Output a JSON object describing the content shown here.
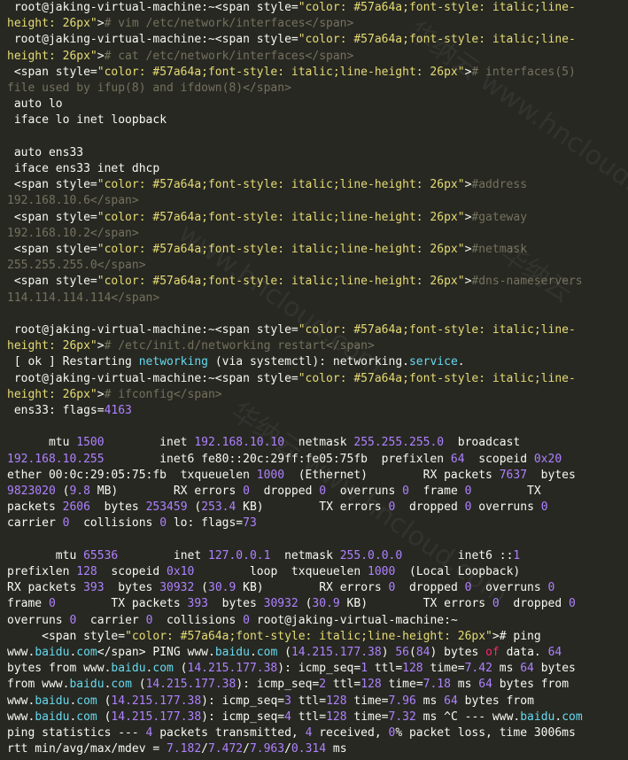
{
  "terminal": {
    "lines": [
      [
        {
          "t": " root@jaking-virtual-machine:~<span style=",
          "c": ""
        },
        {
          "t": "\"color: #57a64a;font-style: italic;line-",
          "c": "st"
        }
      ],
      [
        {
          "t": "height: 26px\"",
          "c": "st"
        },
        {
          "t": ">",
          "c": ""
        },
        {
          "t": "# vim /etc/network/interfaces</span>",
          "c": "cm"
        }
      ],
      [
        {
          "t": " root@jaking-virtual-machine:~<span style=",
          "c": ""
        },
        {
          "t": "\"color: #57a64a;font-style: italic;line-",
          "c": "st"
        }
      ],
      [
        {
          "t": "height: 26px\"",
          "c": "st"
        },
        {
          "t": ">",
          "c": ""
        },
        {
          "t": "# cat /etc/network/interfaces</span>",
          "c": "cm"
        }
      ],
      [
        {
          "t": " <span style=",
          "c": ""
        },
        {
          "t": "\"color: #57a64a;font-style: italic;line-height: 26px\"",
          "c": "st"
        },
        {
          "t": ">",
          "c": ""
        },
        {
          "t": "# interfaces(5)",
          "c": "cm"
        }
      ],
      [
        {
          "t": "file used by ifup(8) and ifdown(8)</span>",
          "c": "cm"
        }
      ],
      [
        {
          "t": " auto lo",
          "c": ""
        }
      ],
      [
        {
          "t": " iface lo inet loopback",
          "c": ""
        }
      ],
      [],
      [
        {
          "t": " auto ens33",
          "c": ""
        }
      ],
      [
        {
          "t": " iface ens33 inet dhcp",
          "c": ""
        }
      ],
      [
        {
          "t": " <span style=",
          "c": ""
        },
        {
          "t": "\"color: #57a64a;font-style: italic;line-height: 26px\"",
          "c": "st"
        },
        {
          "t": ">",
          "c": ""
        },
        {
          "t": "#address",
          "c": "cm"
        }
      ],
      [
        {
          "t": "192.168.10.6</span>",
          "c": "cm"
        }
      ],
      [
        {
          "t": " <span style=",
          "c": ""
        },
        {
          "t": "\"color: #57a64a;font-style: italic;line-height: 26px\"",
          "c": "st"
        },
        {
          "t": ">",
          "c": ""
        },
        {
          "t": "#gateway",
          "c": "cm"
        }
      ],
      [
        {
          "t": "192.168.10.2</span>",
          "c": "cm"
        }
      ],
      [
        {
          "t": " <span style=",
          "c": ""
        },
        {
          "t": "\"color: #57a64a;font-style: italic;line-height: 26px\"",
          "c": "st"
        },
        {
          "t": ">",
          "c": ""
        },
        {
          "t": "#netmask",
          "c": "cm"
        }
      ],
      [
        {
          "t": "255.255.255.0</span>",
          "c": "cm"
        }
      ],
      [
        {
          "t": " <span style=",
          "c": ""
        },
        {
          "t": "\"color: #57a64a;font-style: italic;line-height: 26px\"",
          "c": "st"
        },
        {
          "t": ">",
          "c": ""
        },
        {
          "t": "#dns-nameservers",
          "c": "cm"
        }
      ],
      [
        {
          "t": "114.114.114.114</span>",
          "c": "cm"
        }
      ],
      [],
      [
        {
          "t": " root@jaking-virtual-machine:~<span style=",
          "c": ""
        },
        {
          "t": "\"color: #57a64a;font-style: italic;line-",
          "c": "st"
        }
      ],
      [
        {
          "t": "height: 26px\"",
          "c": "st"
        },
        {
          "t": ">",
          "c": ""
        },
        {
          "t": "# /etc/init.d/networking restart</span>",
          "c": "cm"
        }
      ],
      [
        {
          "t": " [ ok ] Restarting ",
          "c": ""
        },
        {
          "t": "networking",
          "c": "kw"
        },
        {
          "t": " (via systemctl): networking.",
          "c": ""
        },
        {
          "t": "service",
          "c": "kw"
        },
        {
          "t": ".",
          "c": ""
        }
      ],
      [
        {
          "t": " root@jaking-virtual-machine:~<span style=",
          "c": ""
        },
        {
          "t": "\"color: #57a64a;font-style: italic;line-",
          "c": "st"
        }
      ],
      [
        {
          "t": "height: 26px\"",
          "c": "st"
        },
        {
          "t": ">",
          "c": ""
        },
        {
          "t": "# ifconfig</span>",
          "c": "cm"
        }
      ],
      [
        {
          "t": " ens33: flags=",
          "c": ""
        },
        {
          "t": "4163",
          "c": "nm"
        }
      ],
      [],
      [
        {
          "t": "      mtu ",
          "c": ""
        },
        {
          "t": "1500",
          "c": "nm"
        },
        {
          "t": "        inet ",
          "c": ""
        },
        {
          "t": "192.168.10.10",
          "c": "nm"
        },
        {
          "t": "  netmask ",
          "c": ""
        },
        {
          "t": "255.255.255.0",
          "c": "nm"
        },
        {
          "t": "  broadcast",
          "c": ""
        }
      ],
      [
        {
          "t": "192.168.10.255",
          "c": "nm"
        },
        {
          "t": "        inet6 fe80::20c:29ff:fe05:75fb  prefixlen ",
          "c": ""
        },
        {
          "t": "64",
          "c": "nm"
        },
        {
          "t": "  scopeid ",
          "c": ""
        },
        {
          "t": "0x20",
          "c": "nm"
        }
      ],
      [
        {
          "t": "ether 00:0c:29:05:75:fb  txqueuelen ",
          "c": ""
        },
        {
          "t": "1000",
          "c": "nm"
        },
        {
          "t": "  (Ethernet)        RX packets ",
          "c": ""
        },
        {
          "t": "7637",
          "c": "nm"
        },
        {
          "t": "  bytes",
          "c": ""
        }
      ],
      [
        {
          "t": "9823020",
          "c": "nm"
        },
        {
          "t": " (",
          "c": ""
        },
        {
          "t": "9.8",
          "c": "nm"
        },
        {
          "t": " MB)        RX errors ",
          "c": ""
        },
        {
          "t": "0",
          "c": "nm"
        },
        {
          "t": "  dropped ",
          "c": ""
        },
        {
          "t": "0",
          "c": "nm"
        },
        {
          "t": "  overruns ",
          "c": ""
        },
        {
          "t": "0",
          "c": "nm"
        },
        {
          "t": "  frame ",
          "c": ""
        },
        {
          "t": "0",
          "c": "nm"
        },
        {
          "t": "        TX",
          "c": ""
        }
      ],
      [
        {
          "t": "packets ",
          "c": ""
        },
        {
          "t": "2606",
          "c": "nm"
        },
        {
          "t": "  bytes ",
          "c": ""
        },
        {
          "t": "253459",
          "c": "nm"
        },
        {
          "t": " (",
          "c": ""
        },
        {
          "t": "253.4",
          "c": "nm"
        },
        {
          "t": " KB)        TX errors ",
          "c": ""
        },
        {
          "t": "0",
          "c": "nm"
        },
        {
          "t": "  dropped ",
          "c": ""
        },
        {
          "t": "0",
          "c": "nm"
        },
        {
          "t": " overruns ",
          "c": ""
        },
        {
          "t": "0",
          "c": "nm"
        }
      ],
      [
        {
          "t": "carrier ",
          "c": ""
        },
        {
          "t": "0",
          "c": "nm"
        },
        {
          "t": "  collisions ",
          "c": ""
        },
        {
          "t": "0",
          "c": "nm"
        },
        {
          "t": " lo: flags=",
          "c": ""
        },
        {
          "t": "73",
          "c": "nm"
        }
      ],
      [],
      [
        {
          "t": "       mtu ",
          "c": ""
        },
        {
          "t": "65536",
          "c": "nm"
        },
        {
          "t": "        inet ",
          "c": ""
        },
        {
          "t": "127.0.0.1",
          "c": "nm"
        },
        {
          "t": "  netmask ",
          "c": ""
        },
        {
          "t": "255.0.0.0",
          "c": "nm"
        },
        {
          "t": "        inet6 ::",
          "c": ""
        },
        {
          "t": "1",
          "c": "nm"
        }
      ],
      [
        {
          "t": "prefixlen ",
          "c": ""
        },
        {
          "t": "128",
          "c": "nm"
        },
        {
          "t": "  scopeid ",
          "c": ""
        },
        {
          "t": "0x10",
          "c": "nm"
        },
        {
          "t": "        loop  txqueuelen ",
          "c": ""
        },
        {
          "t": "1000",
          "c": "nm"
        },
        {
          "t": "  (Local Loopback)",
          "c": ""
        }
      ],
      [
        {
          "t": "RX packets ",
          "c": ""
        },
        {
          "t": "393",
          "c": "nm"
        },
        {
          "t": "  bytes ",
          "c": ""
        },
        {
          "t": "30932",
          "c": "nm"
        },
        {
          "t": " (",
          "c": ""
        },
        {
          "t": "30.9",
          "c": "nm"
        },
        {
          "t": " KB)        RX errors ",
          "c": ""
        },
        {
          "t": "0",
          "c": "nm"
        },
        {
          "t": "  dropped ",
          "c": ""
        },
        {
          "t": "0",
          "c": "nm"
        },
        {
          "t": "  overruns ",
          "c": ""
        },
        {
          "t": "0",
          "c": "nm"
        }
      ],
      [
        {
          "t": "frame ",
          "c": ""
        },
        {
          "t": "0",
          "c": "nm"
        },
        {
          "t": "        TX packets ",
          "c": ""
        },
        {
          "t": "393",
          "c": "nm"
        },
        {
          "t": "  bytes ",
          "c": ""
        },
        {
          "t": "30932",
          "c": "nm"
        },
        {
          "t": " (",
          "c": ""
        },
        {
          "t": "30.9",
          "c": "nm"
        },
        {
          "t": " KB)        TX errors ",
          "c": ""
        },
        {
          "t": "0",
          "c": "nm"
        },
        {
          "t": "  dropped ",
          "c": ""
        },
        {
          "t": "0",
          "c": "nm"
        }
      ],
      [
        {
          "t": "overruns ",
          "c": ""
        },
        {
          "t": "0",
          "c": "nm"
        },
        {
          "t": "  carrier ",
          "c": ""
        },
        {
          "t": "0",
          "c": "nm"
        },
        {
          "t": "  collisions ",
          "c": ""
        },
        {
          "t": "0",
          "c": "nm"
        },
        {
          "t": " root@jaking-virtual-machine:~",
          "c": ""
        }
      ],
      [
        {
          "t": "     <span style=",
          "c": ""
        },
        {
          "t": "\"color: #57a64a;font-style: italic;line-height: 26px\"",
          "c": "st"
        },
        {
          "t": "># ping",
          "c": ""
        }
      ],
      [
        {
          "t": "www.",
          "c": ""
        },
        {
          "t": "baidu",
          "c": "kw"
        },
        {
          "t": ".",
          "c": ""
        },
        {
          "t": "com",
          "c": "kw"
        },
        {
          "t": "</span> PING www.",
          "c": ""
        },
        {
          "t": "baidu",
          "c": "kw"
        },
        {
          "t": ".",
          "c": ""
        },
        {
          "t": "com",
          "c": "kw"
        },
        {
          "t": " (",
          "c": ""
        },
        {
          "t": "14.215.177.38",
          "c": "nm"
        },
        {
          "t": ") ",
          "c": ""
        },
        {
          "t": "56",
          "c": "nm"
        },
        {
          "t": "(",
          "c": ""
        },
        {
          "t": "84",
          "c": "nm"
        },
        {
          "t": ") bytes ",
          "c": ""
        },
        {
          "t": "of",
          "c": "op"
        },
        {
          "t": " data. ",
          "c": ""
        },
        {
          "t": "64",
          "c": "nm"
        }
      ],
      [
        {
          "t": "bytes from www.",
          "c": ""
        },
        {
          "t": "baidu",
          "c": "kw"
        },
        {
          "t": ".",
          "c": ""
        },
        {
          "t": "com",
          "c": "kw"
        },
        {
          "t": " (",
          "c": ""
        },
        {
          "t": "14.215.177.38",
          "c": "nm"
        },
        {
          "t": "): icmp_seq=",
          "c": ""
        },
        {
          "t": "1",
          "c": "nm"
        },
        {
          "t": " ttl=",
          "c": ""
        },
        {
          "t": "128",
          "c": "nm"
        },
        {
          "t": " time=",
          "c": ""
        },
        {
          "t": "7.42",
          "c": "nm"
        },
        {
          "t": " ms ",
          "c": ""
        },
        {
          "t": "64",
          "c": "nm"
        },
        {
          "t": " bytes",
          "c": ""
        }
      ],
      [
        {
          "t": "from www.",
          "c": ""
        },
        {
          "t": "baidu",
          "c": "kw"
        },
        {
          "t": ".",
          "c": ""
        },
        {
          "t": "com",
          "c": "kw"
        },
        {
          "t": " (",
          "c": ""
        },
        {
          "t": "14.215.177.38",
          "c": "nm"
        },
        {
          "t": "): icmp_seq=",
          "c": ""
        },
        {
          "t": "2",
          "c": "nm"
        },
        {
          "t": " ttl=",
          "c": ""
        },
        {
          "t": "128",
          "c": "nm"
        },
        {
          "t": " time=",
          "c": ""
        },
        {
          "t": "7.18",
          "c": "nm"
        },
        {
          "t": " ms ",
          "c": ""
        },
        {
          "t": "64",
          "c": "nm"
        },
        {
          "t": " bytes from",
          "c": ""
        }
      ],
      [
        {
          "t": "www.",
          "c": ""
        },
        {
          "t": "baidu",
          "c": "kw"
        },
        {
          "t": ".",
          "c": ""
        },
        {
          "t": "com",
          "c": "kw"
        },
        {
          "t": " (",
          "c": ""
        },
        {
          "t": "14.215.177.38",
          "c": "nm"
        },
        {
          "t": "): icmp_seq=",
          "c": ""
        },
        {
          "t": "3",
          "c": "nm"
        },
        {
          "t": " ttl=",
          "c": ""
        },
        {
          "t": "128",
          "c": "nm"
        },
        {
          "t": " time=",
          "c": ""
        },
        {
          "t": "7.96",
          "c": "nm"
        },
        {
          "t": " ms ",
          "c": ""
        },
        {
          "t": "64",
          "c": "nm"
        },
        {
          "t": " bytes from",
          "c": ""
        }
      ],
      [
        {
          "t": "www.",
          "c": ""
        },
        {
          "t": "baidu",
          "c": "kw"
        },
        {
          "t": ".",
          "c": ""
        },
        {
          "t": "com",
          "c": "kw"
        },
        {
          "t": " (",
          "c": ""
        },
        {
          "t": "14.215.177.38",
          "c": "nm"
        },
        {
          "t": "): icmp_seq=",
          "c": ""
        },
        {
          "t": "4",
          "c": "nm"
        },
        {
          "t": " ttl=",
          "c": ""
        },
        {
          "t": "128",
          "c": "nm"
        },
        {
          "t": " time=",
          "c": ""
        },
        {
          "t": "7.32",
          "c": "nm"
        },
        {
          "t": " ms ^C --- www.",
          "c": ""
        },
        {
          "t": "baidu",
          "c": "kw"
        },
        {
          "t": ".",
          "c": ""
        },
        {
          "t": "com",
          "c": "kw"
        }
      ],
      [
        {
          "t": "ping statistics --- ",
          "c": ""
        },
        {
          "t": "4",
          "c": "nm"
        },
        {
          "t": " packets transmitted, ",
          "c": ""
        },
        {
          "t": "4",
          "c": "nm"
        },
        {
          "t": " received, ",
          "c": ""
        },
        {
          "t": "0",
          "c": "nm"
        },
        {
          "t": "% packet loss, time 3006ms",
          "c": ""
        }
      ],
      [
        {
          "t": "rtt min/avg/max/mdev = ",
          "c": ""
        },
        {
          "t": "7.182",
          "c": "nm"
        },
        {
          "t": "/",
          "c": ""
        },
        {
          "t": "7.472",
          "c": "nm"
        },
        {
          "t": "/",
          "c": ""
        },
        {
          "t": "7.963",
          "c": "nm"
        },
        {
          "t": "/",
          "c": ""
        },
        {
          "t": "0.314",
          "c": "nm"
        },
        {
          "t": " ms",
          "c": ""
        }
      ]
    ]
  },
  "watermark": {
    "texts": [
      "华纳云 www.hncloud.com",
      "www.hncloud.com",
      "华纳云",
      "华纳云 www.hncloud.com"
    ]
  },
  "colors": {
    "background": "#272822",
    "text": "#f8f8f2",
    "comment": "#75715e",
    "string": "#e6db74",
    "number": "#ae81ff",
    "keyword": "#66d9ef",
    "operator": "#f92672"
  }
}
